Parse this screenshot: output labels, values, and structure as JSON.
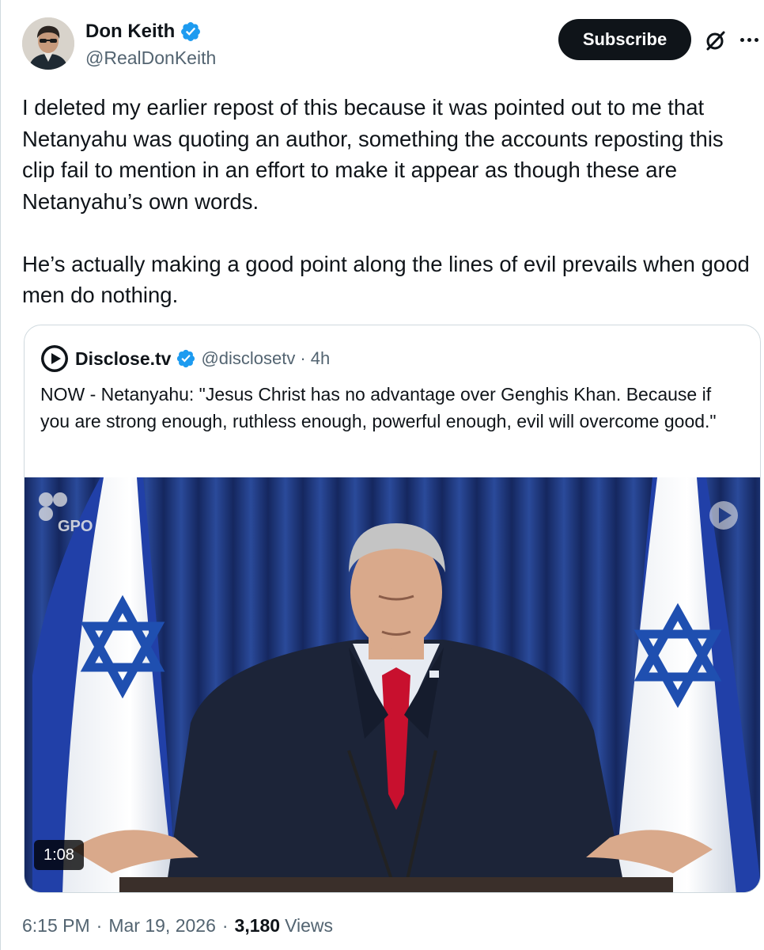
{
  "post": {
    "author_name": "Don Keith",
    "author_handle": "@RealDonKeith",
    "subscribe_label": "Subscribe",
    "paragraphs": [
      "I deleted my earlier repost of this because it was pointed out to me that Netanyahu was quoting an author, something the accounts reposting this clip fail to mention in an effort to make it appear as though these are Netanyahu’s own words.",
      "He’s actually making a good point along the lines of evil prevails when good men do nothing."
    ],
    "time": "6:15 PM",
    "date": "Mar 19, 2026",
    "views_count": "3,180",
    "views_label": "Views"
  },
  "quote": {
    "name": "Disclose.tv",
    "handle": "@disclosetv",
    "age": "4h",
    "text": "NOW - Netanyahu: \"Jesus Christ has no advantage over Genghis Khan. Because if you are strong enough, ruthless enough, powerful enough, evil will overcome good.\"",
    "video_duration": "1:08",
    "watermark": "GPO"
  },
  "icons": {
    "verified": "verified-badge-icon",
    "grok": "grok-icon",
    "more": "more-icon",
    "disclose_logo": "disclose-logo-icon",
    "play": "play-watermark-icon"
  },
  "colors": {
    "verified_blue": "#1d9bf0",
    "text_primary": "#0f1419",
    "text_secondary": "#536471",
    "subscribe_bg": "#0f1419",
    "flag_blue": "#1f4fb0",
    "curtain_blue": "#1a3072",
    "tie_red": "#c8102e"
  }
}
